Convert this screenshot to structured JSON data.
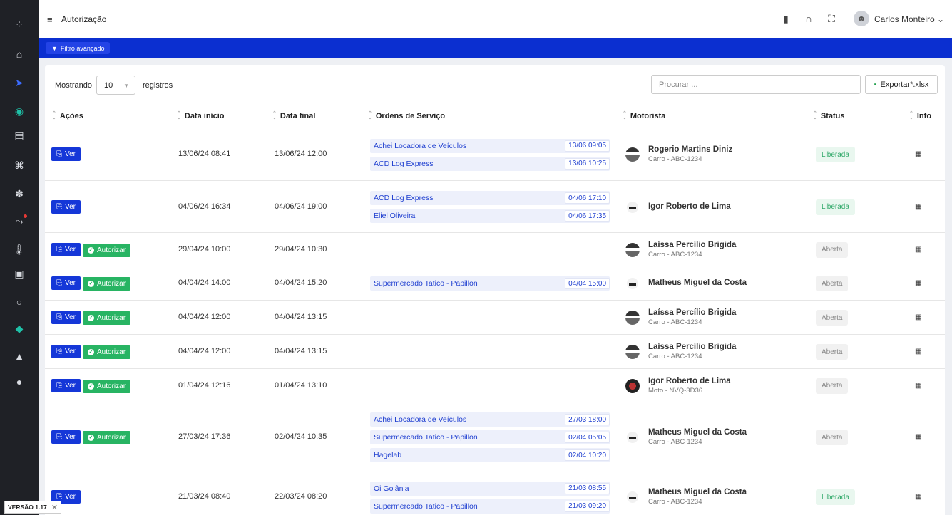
{
  "header": {
    "title": "Autorização",
    "user": "Carlos Monteiro ⌄"
  },
  "filter": {
    "label": "Filtro avançado"
  },
  "table_controls": {
    "show_label": "Mostrando",
    "page_size": "10",
    "records_label": "registros",
    "search_placeholder": "Procurar ...",
    "export_label": "Exportar*.xlsx"
  },
  "columns": {
    "acoes": "Ações",
    "inicio": "Data início",
    "final": "Data final",
    "os": "Ordens de Serviço",
    "motorista": "Motorista",
    "status": "Status",
    "info": "Info"
  },
  "buttons": {
    "ver": "Ver",
    "autorizar": "Autorizar"
  },
  "rows": [
    {
      "inicio": "13/06/24 08:41",
      "final": "13/06/24 12:00",
      "autorizar": false,
      "os": [
        {
          "name": "Achei Locadora de Veículos",
          "time": "13/06 09:05"
        },
        {
          "name": "ACD Log Express",
          "time": "13/06 10:25"
        }
      ],
      "driver": "Rogerio Martins Diniz",
      "vehicle": "Carro - ABC-1234",
      "icon": "car-photo",
      "status": "Liberada"
    },
    {
      "inicio": "04/06/24 16:34",
      "final": "04/06/24 19:00",
      "autorizar": false,
      "os": [
        {
          "name": "ACD Log Express",
          "time": "04/06 17:10"
        },
        {
          "name": "Eliel Oliveira",
          "time": "04/06 17:35"
        }
      ],
      "driver": "Igor Roberto de Lima",
      "vehicle": "",
      "icon": "car-glyph",
      "status": "Liberada"
    },
    {
      "inicio": "29/04/24 10:00",
      "final": "29/04/24 10:30",
      "autorizar": true,
      "os": [],
      "driver": "Laíssa Percílio Brigida",
      "vehicle": "Carro - ABC-1234",
      "icon": "car-photo",
      "status": "Aberta"
    },
    {
      "inicio": "04/04/24 14:00",
      "final": "04/04/24 15:20",
      "autorizar": true,
      "os": [
        {
          "name": "Supermercado Tatico - Papillon",
          "time": "04/04 15:00"
        }
      ],
      "driver": "Matheus Miguel da Costa",
      "vehicle": "",
      "icon": "car-glyph",
      "status": "Aberta"
    },
    {
      "inicio": "04/04/24 12:00",
      "final": "04/04/24 13:15",
      "autorizar": true,
      "os": [],
      "driver": "Laíssa Percílio Brigida",
      "vehicle": "Carro - ABC-1234",
      "icon": "car-photo",
      "status": "Aberta"
    },
    {
      "inicio": "04/04/24 12:00",
      "final": "04/04/24 13:15",
      "autorizar": true,
      "os": [],
      "driver": "Laíssa Percílio Brigida",
      "vehicle": "Carro - ABC-1234",
      "icon": "car-photo",
      "status": "Aberta"
    },
    {
      "inicio": "01/04/24 12:16",
      "final": "01/04/24 13:10",
      "autorizar": true,
      "os": [],
      "driver": "Igor Roberto de Lima",
      "vehicle": "Moto - NVQ-3D36",
      "icon": "moto-photo",
      "status": "Aberta"
    },
    {
      "inicio": "27/03/24 17:36",
      "final": "02/04/24 10:35",
      "autorizar": true,
      "os": [
        {
          "name": "Achei Locadora de Veículos",
          "time": "27/03 18:00"
        },
        {
          "name": "Supermercado Tatico - Papillon",
          "time": "02/04 05:05"
        },
        {
          "name": "Hagelab",
          "time": "02/04 10:20"
        }
      ],
      "driver": "Matheus Miguel da Costa",
      "vehicle": "Carro - ABC-1234",
      "icon": "car-glyph",
      "status": "Aberta"
    },
    {
      "inicio": "21/03/24 08:40",
      "final": "22/03/24 08:20",
      "autorizar": false,
      "os": [
        {
          "name": "Oi Goiânia",
          "time": "21/03 08:55"
        },
        {
          "name": "Supermercado Tatico - Papillon",
          "time": "21/03 09:20"
        }
      ],
      "driver": "Matheus Miguel da Costa",
      "vehicle": "Carro - ABC-1234",
      "icon": "car-glyph",
      "status": "Liberada"
    }
  ],
  "version": {
    "label": "VERSÃO 1.17"
  }
}
